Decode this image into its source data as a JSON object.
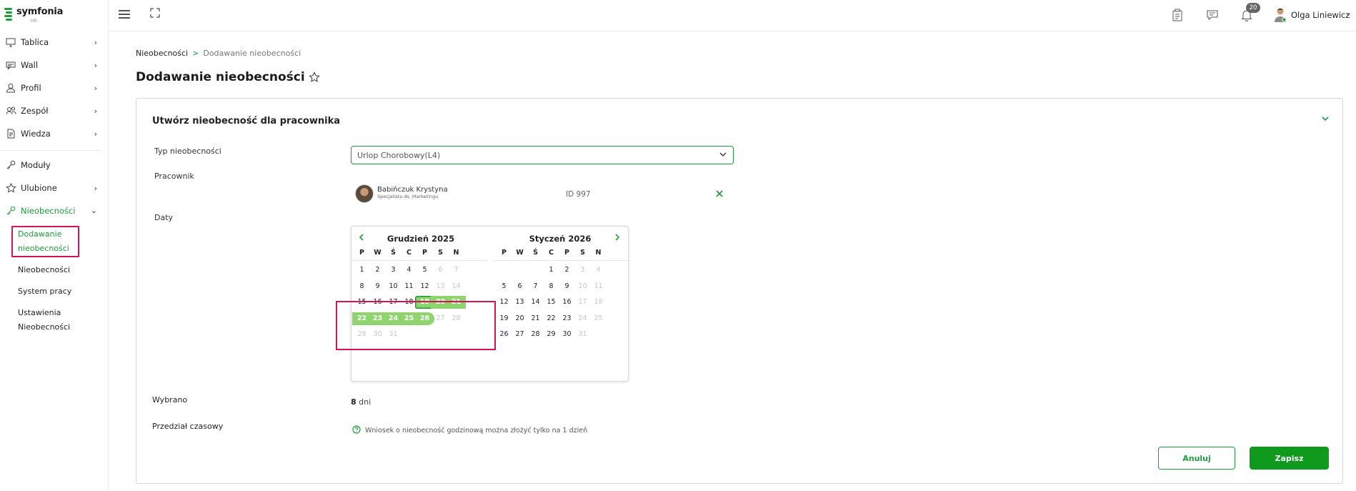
{
  "app": {
    "logo_name": "symfonia",
    "logo_sub": "HR"
  },
  "sidebar": {
    "items": [
      {
        "label": "Tablica",
        "icon": "monitor-icon"
      },
      {
        "label": "Wall",
        "icon": "chat-board-icon"
      },
      {
        "label": "Profil",
        "icon": "user-icon"
      },
      {
        "label": "Zespół",
        "icon": "team-icon"
      },
      {
        "label": "Wiedza",
        "icon": "document-icon"
      },
      {
        "label": "Moduły",
        "icon": "key-icon"
      },
      {
        "label": "Ulubione",
        "icon": "star-icon"
      },
      {
        "label": "Nieobecności",
        "icon": "key-icon"
      }
    ],
    "subitems": [
      {
        "label": "Dodawanie nieobecności"
      },
      {
        "label": "Nieobecności"
      },
      {
        "label": "System pracy"
      },
      {
        "label": "Ustawienia Nieobecności"
      }
    ]
  },
  "topbar": {
    "notifications_count": "20",
    "username": "Olga Liniewicz"
  },
  "breadcrumb": {
    "parent": "Nieobecności",
    "separator": ">",
    "current": "Dodawanie nieobecności"
  },
  "page": {
    "title": "Dodawanie nieobecności"
  },
  "form": {
    "card_title": "Utwórz nieobecność dla pracownika",
    "type_label": "Typ nieobecności",
    "type_value": "Urlop Chorobowy(L4)",
    "employee_label": "Pracownik",
    "employee": {
      "name": "Babińczuk Krystyna",
      "role": "Specjalista ds. Marketingu",
      "id": "ID 997"
    },
    "dates_label": "Daty",
    "selected_label": "Wybrano",
    "selected_count": "8",
    "selected_unit": "dni",
    "interval_label": "Przedział czasowy",
    "interval_info": "Wniosek o nieobecność godzinową można złożyć tylko na 1 dzień",
    "cancel_label": "Anuluj",
    "save_label": "Zapisz"
  },
  "calendar": {
    "weekdays": [
      "P",
      "W",
      "Ś",
      "C",
      "P",
      "S",
      "N"
    ],
    "months": [
      {
        "title": "Grudzień 2025",
        "weeks": [
          [
            "1",
            "2",
            "3",
            "4",
            "5",
            "6",
            "7"
          ],
          [
            "8",
            "9",
            "10",
            "11",
            "12",
            "13",
            "14"
          ],
          [
            "15",
            "16",
            "17",
            "18",
            "19",
            "20",
            "21"
          ],
          [
            "22",
            "23",
            "24",
            "25",
            "26",
            "27",
            "28"
          ],
          [
            "29",
            "30",
            "31",
            "",
            "",
            "",
            ""
          ]
        ]
      },
      {
        "title": "Styczeń 2026",
        "weeks": [
          [
            "",
            "",
            "",
            "1",
            "2",
            "3",
            "4"
          ],
          [
            "5",
            "6",
            "7",
            "8",
            "9",
            "10",
            "11"
          ],
          [
            "12",
            "13",
            "14",
            "15",
            "16",
            "17",
            "18"
          ],
          [
            "19",
            "20",
            "21",
            "22",
            "23",
            "24",
            "25"
          ],
          [
            "26",
            "27",
            "28",
            "29",
            "30",
            "31",
            ""
          ]
        ]
      }
    ],
    "today": "19",
    "range_start": "19",
    "range_end": "26"
  },
  "colors": {
    "brand": "#1f9c3a",
    "range": "#8fd46e",
    "highlight": "#d0155a"
  }
}
